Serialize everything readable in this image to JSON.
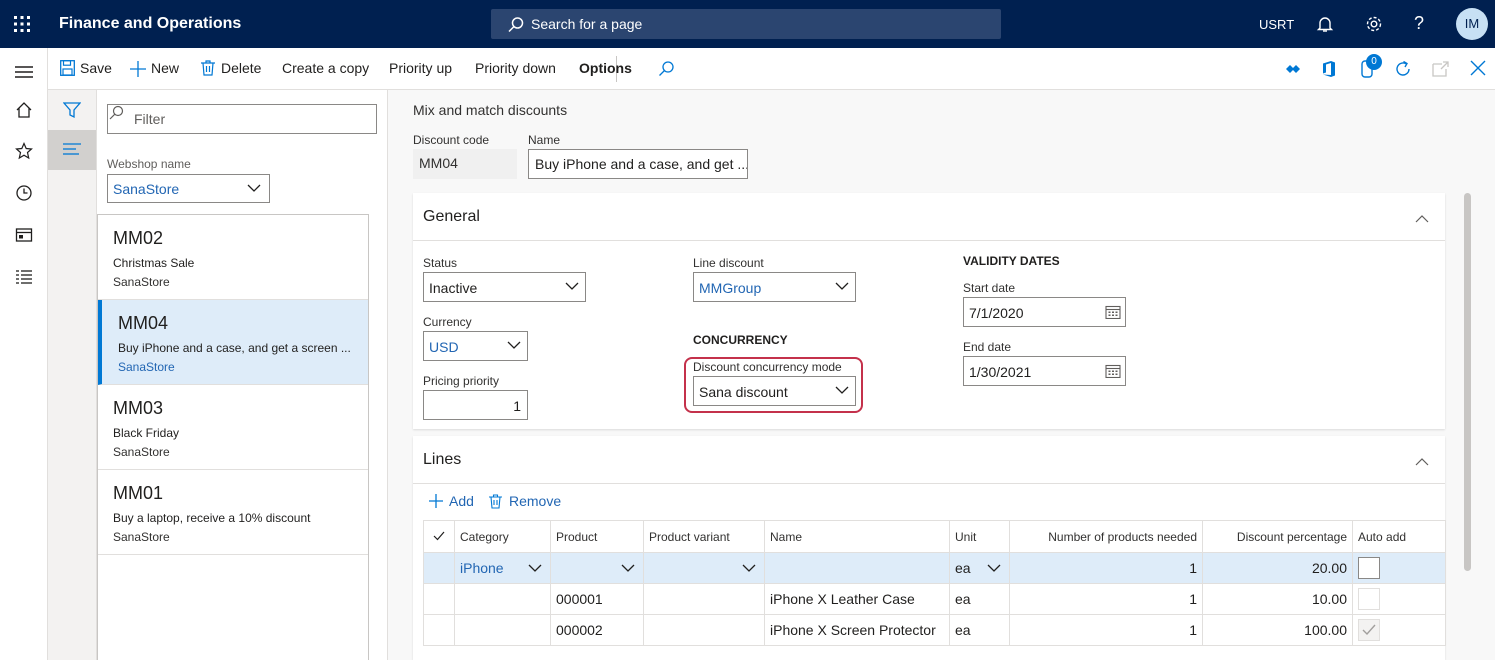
{
  "topbar": {
    "app_title": "Finance and Operations",
    "search_placeholder": "Search for a page",
    "company": "USRT",
    "user_initials": "IM"
  },
  "actions": {
    "save": "Save",
    "new": "New",
    "delete": "Delete",
    "create_copy": "Create a copy",
    "priority_up": "Priority up",
    "priority_down": "Priority down",
    "options": "Options",
    "attachments_count": "0"
  },
  "listpanel": {
    "filter_placeholder": "Filter",
    "webshop_label": "Webshop name",
    "webshop_value": "SanaStore",
    "records": [
      {
        "code": "MM02",
        "desc": "Christmas Sale",
        "store": "SanaStore"
      },
      {
        "code": "MM04",
        "desc": "Buy iPhone and a case, and get a screen ...",
        "store": "SanaStore"
      },
      {
        "code": "MM03",
        "desc": "Black Friday",
        "store": "SanaStore"
      },
      {
        "code": "MM01",
        "desc": "Buy a laptop, receive a 10% discount",
        "store": "SanaStore"
      }
    ]
  },
  "detail": {
    "caption": "Mix and match discounts",
    "discount_code_label": "Discount code",
    "discount_code": "MM04",
    "name_label": "Name",
    "name": "Buy iPhone and a case, and get ...",
    "general": {
      "title": "General",
      "status_label": "Status",
      "status": "Inactive",
      "currency_label": "Currency",
      "currency": "USD",
      "pricing_priority_label": "Pricing priority",
      "pricing_priority": "1",
      "line_discount_label": "Line discount",
      "line_discount": "MMGroup",
      "concurrency_header": "CONCURRENCY",
      "concurrency_mode_label": "Discount concurrency mode",
      "concurrency_mode": "Sana discount",
      "validity_header": "VALIDITY DATES",
      "start_date_label": "Start date",
      "start_date": "7/1/2020",
      "end_date_label": "End date",
      "end_date": "1/30/2021"
    },
    "lines": {
      "title": "Lines",
      "add": "Add",
      "remove": "Remove",
      "columns": [
        "Category",
        "Product",
        "Product variant",
        "Name",
        "Unit",
        "Number of products needed",
        "Discount percentage",
        "Auto add"
      ],
      "rows": [
        {
          "category": "iPhone",
          "product": "",
          "variant": "",
          "name": "",
          "unit": "ea",
          "qty": "1",
          "pct": "20.00"
        },
        {
          "category": "",
          "product": "000001",
          "variant": "",
          "name": "iPhone X Leather Case",
          "unit": "ea",
          "qty": "1",
          "pct": "10.00"
        },
        {
          "category": "",
          "product": "000002",
          "variant": "",
          "name": "iPhone X Screen Protector",
          "unit": "ea",
          "qty": "1",
          "pct": "100.00"
        }
      ]
    }
  },
  "colors": {
    "topbar": "#002050",
    "accent": "#0078d4",
    "link": "#2266b3",
    "selected_row": "#deecf9",
    "highlight": "#c4314b"
  }
}
